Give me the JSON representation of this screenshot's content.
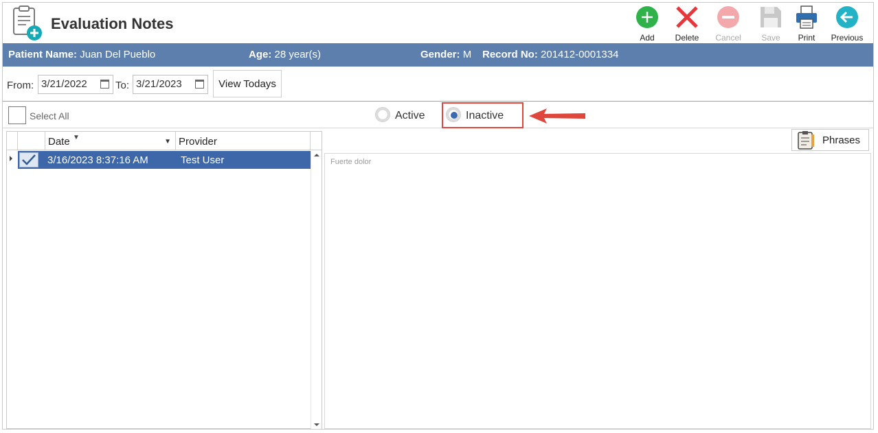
{
  "header": {
    "title": "Evaluation Notes",
    "toolbar": {
      "add": "Add",
      "delete": "Delete",
      "cancel": "Cancel",
      "save": "Save",
      "print": "Print",
      "previous": "Previous"
    }
  },
  "patient": {
    "name_label": "Patient Name:",
    "name": "Juan Del Pueblo",
    "age_label": "Age:",
    "age": "28 year(s)",
    "gender_label": "Gender:",
    "gender": "M",
    "record_label": "Record No:",
    "record": "201412-0001334"
  },
  "date_filter": {
    "from_label": "From:",
    "from": "3/21/2022",
    "to_label": "To:",
    "to": "3/21/2023",
    "view_todays": "View Todays"
  },
  "filters": {
    "select_all": "Select All",
    "active": "Active",
    "inactive": "Inactive",
    "selected": "Inactive"
  },
  "grid": {
    "columns": [
      "Date",
      "Provider"
    ],
    "rows": [
      {
        "date": "3/16/2023 8:37:16 AM",
        "provider": "Test User",
        "checked": true
      }
    ]
  },
  "notes": {
    "phrases_button": "Phrases",
    "text": "Fuerte dolor"
  },
  "colors": {
    "patient_bar": "#5c7fae",
    "selected_row": "#3d67a8",
    "highlight": "#e0473c",
    "add": "#2fb24a",
    "delete": "#e8373a"
  }
}
